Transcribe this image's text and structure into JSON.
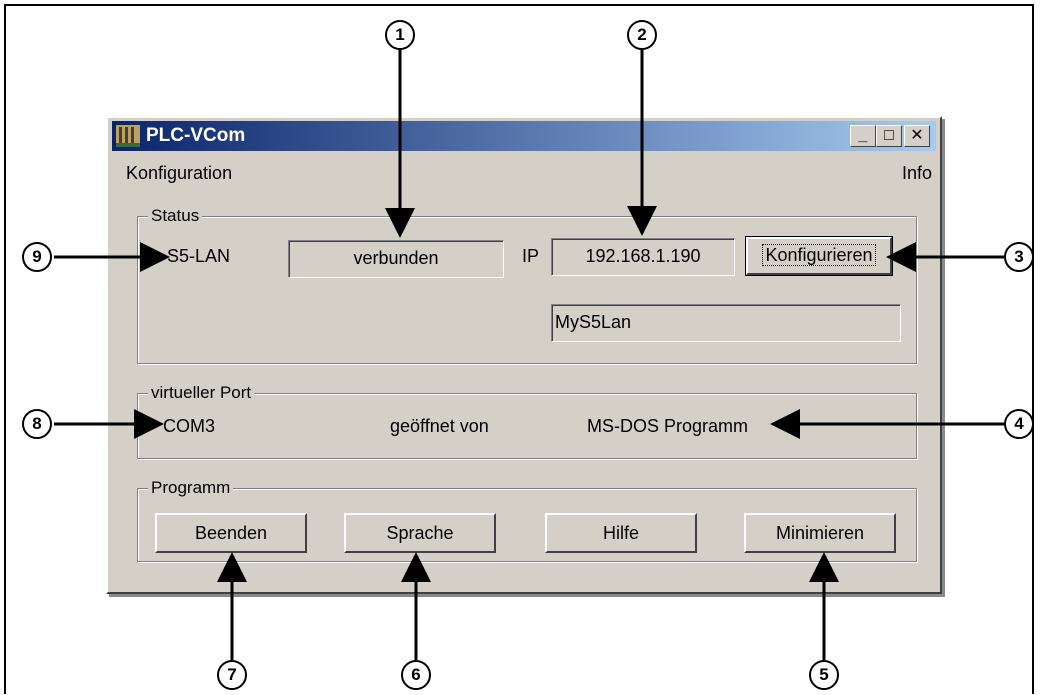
{
  "window": {
    "title": "PLC-VCom",
    "controls": {
      "minimize": "_",
      "maximize": "□",
      "close": "✕"
    }
  },
  "menu": {
    "left": "Konfiguration",
    "right": "Info"
  },
  "status": {
    "group_label": "Status",
    "device_label": "S5-LAN",
    "connection_state": "verbunden",
    "ip_label": "IP",
    "ip_value": "192.168.1.190",
    "configure_button": "Konfigurieren",
    "device_name": "MyS5Lan"
  },
  "virtual_port": {
    "group_label": "virtueller Port",
    "port": "COM3",
    "opened_by_label": "geöffnet von",
    "opened_by_value": "MS-DOS Programm"
  },
  "program": {
    "group_label": "Programm",
    "buttons": [
      "Beenden",
      "Sprache",
      "Hilfe",
      "Minimieren"
    ]
  },
  "callouts": [
    "1",
    "2",
    "3",
    "4",
    "5",
    "6",
    "7",
    "8",
    "9"
  ]
}
